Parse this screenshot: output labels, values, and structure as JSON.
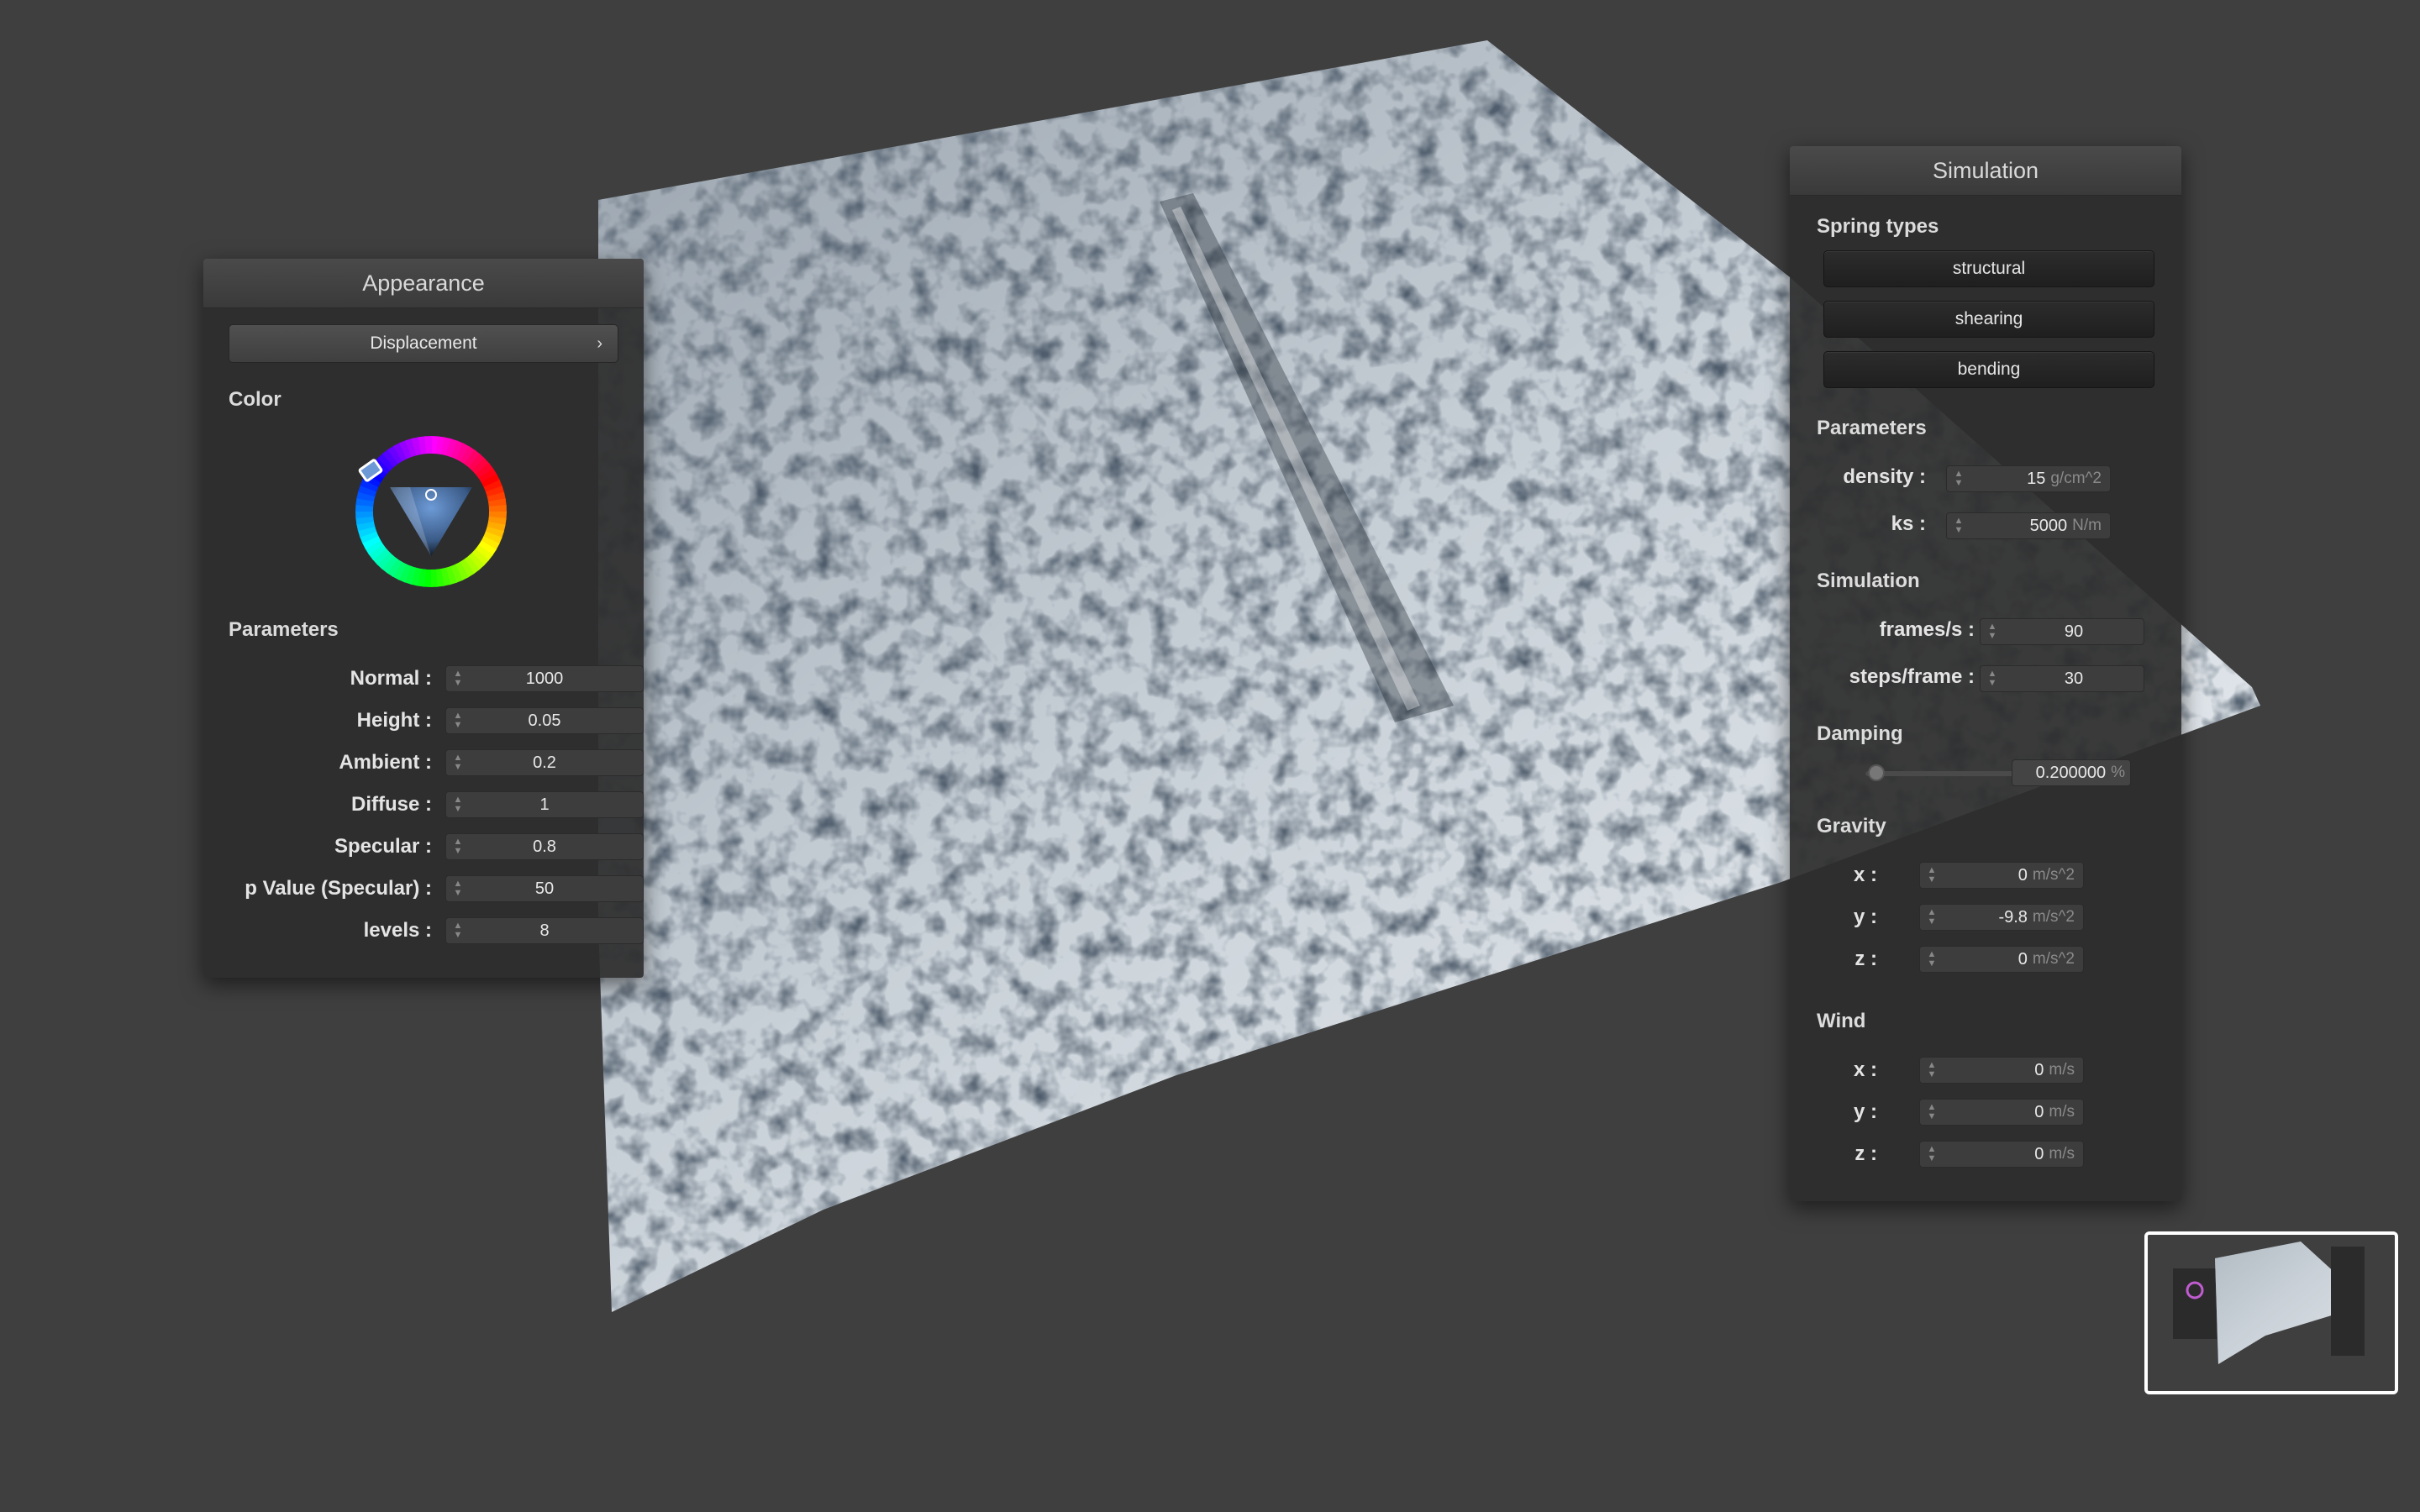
{
  "appearance": {
    "title": "Appearance",
    "shader_dropdown": "Displacement",
    "color_label": "Color",
    "parameters_label": "Parameters",
    "params": [
      {
        "label": "Normal :",
        "value": "1000"
      },
      {
        "label": "Height :",
        "value": "0.05"
      },
      {
        "label": "Ambient :",
        "value": "0.2"
      },
      {
        "label": "Diffuse :",
        "value": "1"
      },
      {
        "label": "Specular :",
        "value": "0.8"
      },
      {
        "label": "p Value (Specular) :",
        "value": "50"
      },
      {
        "label": "levels :",
        "value": "8"
      }
    ]
  },
  "simulation": {
    "title": "Simulation",
    "spring_types_label": "Spring types",
    "spring_buttons": [
      "structural",
      "shearing",
      "bending"
    ],
    "parameters_label": "Parameters",
    "density": {
      "label": "density :",
      "value": "15",
      "unit": "g/cm^2"
    },
    "ks": {
      "label": "ks :",
      "value": "5000",
      "unit": "N/m"
    },
    "simulation_label": "Simulation",
    "frames": {
      "label": "frames/s :",
      "value": "90"
    },
    "steps": {
      "label": "steps/frame :",
      "value": "30"
    },
    "damping_label": "Damping",
    "damping": {
      "value": "0.200000",
      "unit": "%",
      "slider_fraction": 0.02
    },
    "gravity_label": "Gravity",
    "gravity": [
      {
        "label": "x :",
        "value": "0",
        "unit": "m/s^2"
      },
      {
        "label": "y :",
        "value": "-9.8",
        "unit": "m/s^2"
      },
      {
        "label": "z :",
        "value": "0",
        "unit": "m/s^2"
      }
    ],
    "wind_label": "Wind",
    "wind": [
      {
        "label": "x :",
        "value": "0",
        "unit": "m/s"
      },
      {
        "label": "y :",
        "value": "0",
        "unit": "m/s"
      },
      {
        "label": "z :",
        "value": "0",
        "unit": "m/s"
      }
    ]
  },
  "colors": {
    "background": "#3f3f3f",
    "panel": "#2d2d2d",
    "selected_color": "#6d9ad6"
  }
}
